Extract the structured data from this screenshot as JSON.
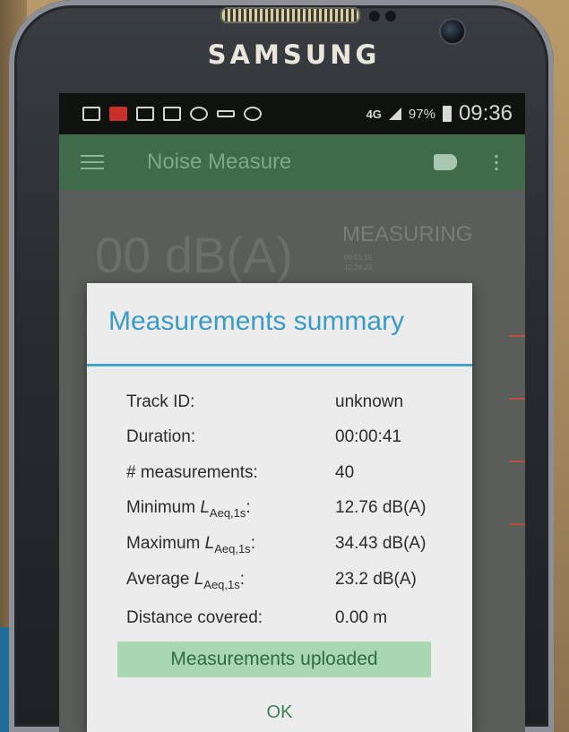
{
  "device": {
    "brand": "SAMSUNG"
  },
  "status_bar": {
    "network": "4G",
    "battery": "97%",
    "time": "09:36"
  },
  "app_bar": {
    "title": "Noise Measure"
  },
  "background": {
    "level": "00 dB(A)",
    "status": "MEASURING",
    "elapsed": "00:01:15",
    "time2": "12:34:23"
  },
  "dialog": {
    "title": "Measurements summary",
    "rows": [
      {
        "label": "Track ID:",
        "value": "unknown"
      },
      {
        "label": "Duration:",
        "value": "00:00:41"
      },
      {
        "label": "# measurements:",
        "value": "40"
      },
      {
        "label": "Minimum ",
        "label_sym": "L",
        "label_sub": "Aeq,1s",
        "label_end": ":",
        "value": "12.76 dB(A)"
      },
      {
        "label": "Maximum ",
        "label_sym": "L",
        "label_sub": "Aeq,1s",
        "label_end": ":",
        "value": "34.43 dB(A)"
      },
      {
        "label": "Average ",
        "label_sym": "L",
        "label_sub": "Aeq,1s",
        "label_end": ":",
        "value": "23.2 dB(A)"
      },
      {
        "label": "Distance covered:",
        "value": "0.00 m"
      }
    ],
    "upload_status": "Measurements uploaded",
    "ok_label": "OK"
  }
}
